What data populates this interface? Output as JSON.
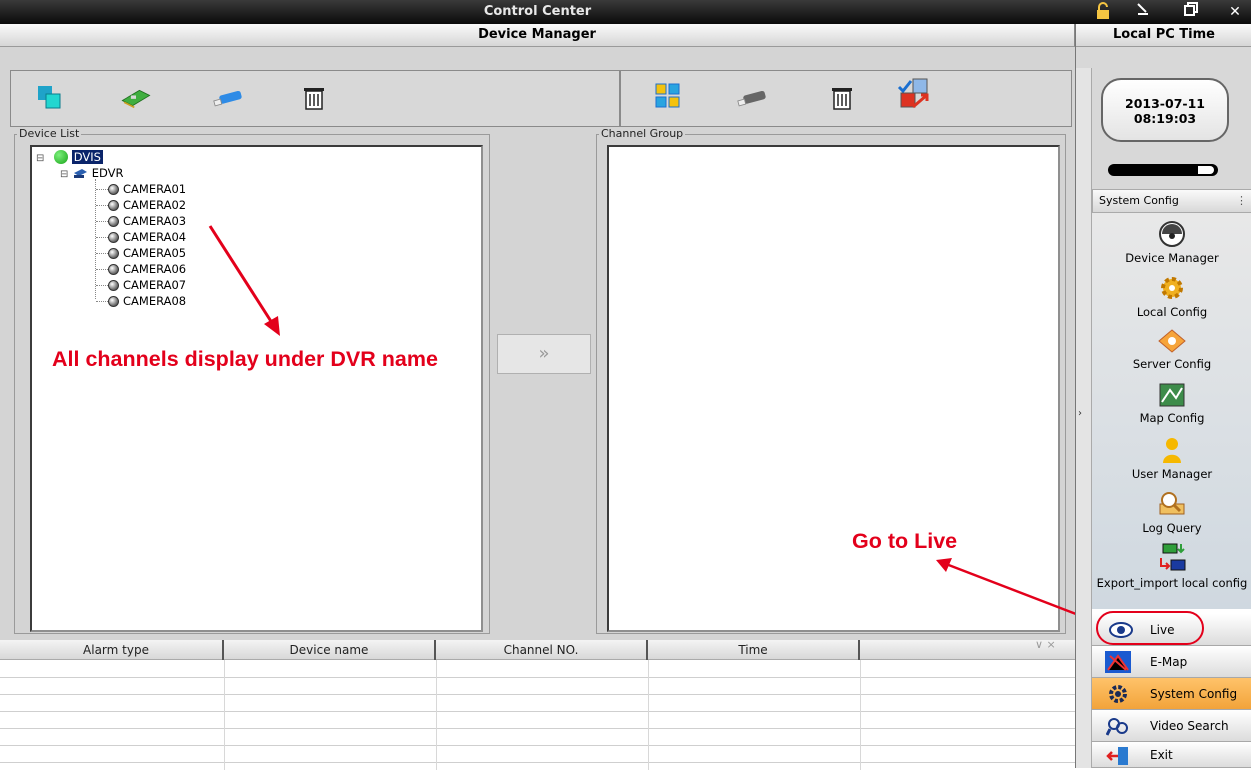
{
  "window": {
    "title": "Control Center"
  },
  "header": {
    "title": "Device Manager",
    "local_time_title": "Local PC Time"
  },
  "clock": {
    "date": "2013-07-11",
    "time": "08:19:03"
  },
  "device_list": {
    "label": "Device List",
    "root": "DVIS",
    "dvr": "EDVR",
    "cameras": [
      "CAMERA01",
      "CAMERA02",
      "CAMERA03",
      "CAMERA04",
      "CAMERA05",
      "CAMERA06",
      "CAMERA07",
      "CAMERA08"
    ]
  },
  "channel_group": {
    "label": "Channel Group"
  },
  "transfer_button": "»",
  "alarm_table": {
    "columns": [
      "Alarm type",
      "Device name",
      "Channel NO.",
      "Time"
    ],
    "controls": "∨ ×"
  },
  "system_config": {
    "title": "System Config",
    "items": [
      "Device Manager",
      "Local Config",
      "Server Config",
      "Map Config",
      "User Manager",
      "Log Query",
      "Export_import local config"
    ]
  },
  "nav": {
    "items": [
      {
        "label": "Live",
        "icon": "eye-icon"
      },
      {
        "label": "E-Map",
        "icon": "map-icon"
      },
      {
        "label": "System Config",
        "icon": "gear-icon"
      },
      {
        "label": "Video Search",
        "icon": "search-people-icon"
      },
      {
        "label": "Exit",
        "icon": "exit-icon"
      }
    ]
  },
  "annotations": {
    "channels_note": "All channels display under DVR name",
    "live_note": "Go to Live"
  },
  "colors": {
    "annotation_red": "#e3001b",
    "active_nav": "#f2a33a"
  }
}
